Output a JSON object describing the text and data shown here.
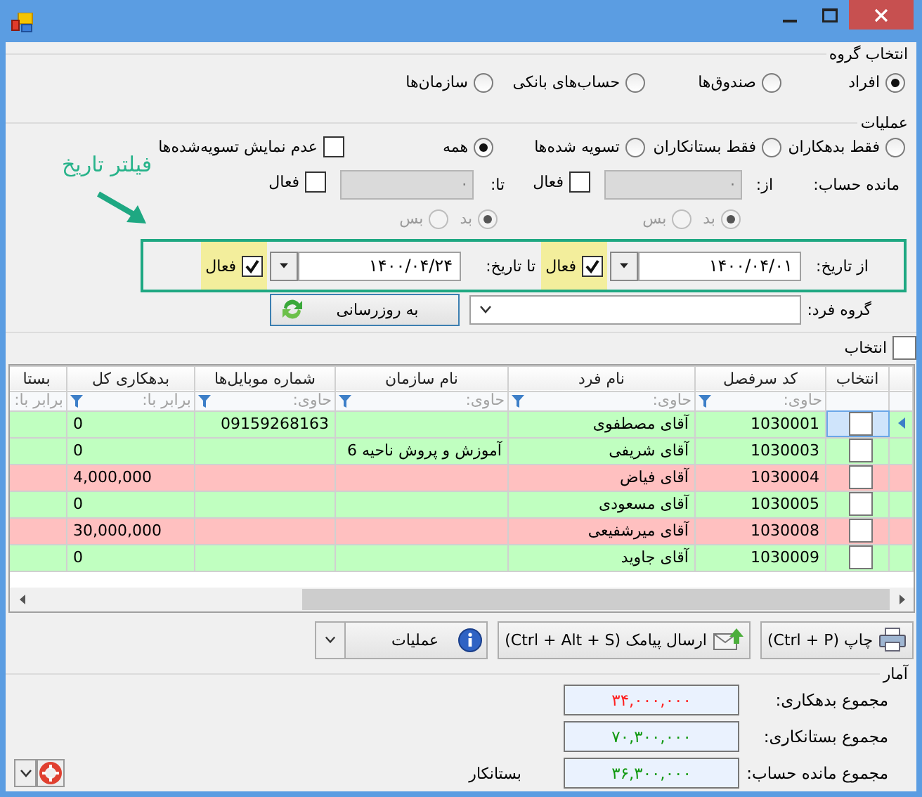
{
  "group_selection": {
    "legend": "انتخاب گروه",
    "options": [
      {
        "label": "افراد",
        "selected": true
      },
      {
        "label": "صندوق‌ها",
        "selected": false
      },
      {
        "label": "حساب‌های بانکی",
        "selected": false
      },
      {
        "label": "سازمان‌ها",
        "selected": false
      }
    ]
  },
  "operations": {
    "legend": "عملیات",
    "filters": [
      {
        "label": "فقط بدهکاران",
        "selected": false
      },
      {
        "label": "فقط بستانکاران",
        "selected": false
      },
      {
        "label": "تسویه شده‌ها",
        "selected": false
      },
      {
        "label": "همه",
        "selected": true
      }
    ],
    "hide_settled": {
      "label": "عدم نمایش تسویه‌شده‌ها",
      "checked": false
    },
    "balance": {
      "label": "مانده حساب:",
      "ranges": [
        {
          "label": "از:",
          "placeholder": "·",
          "disabled": true,
          "active": {
            "label": "فعال",
            "checked": false
          },
          "sides": [
            {
              "label": "بد",
              "selected": true,
              "disabled": true
            },
            {
              "label": "بس",
              "selected": false,
              "disabled": true
            }
          ]
        },
        {
          "label": "تا:",
          "placeholder": "·",
          "disabled": true,
          "active": {
            "label": "فعال",
            "checked": false
          },
          "sides": [
            {
              "label": "بد",
              "selected": true,
              "disabled": true
            },
            {
              "label": "بس",
              "selected": false,
              "disabled": true
            }
          ]
        }
      ]
    },
    "date_filter": {
      "annotation": "فیلتر تاریخ",
      "ranges": [
        {
          "label": "از تاریخ:",
          "value": "۱۴۰۰/۰۴/۰۱",
          "active": {
            "label": "فعال",
            "checked": true,
            "highlighted": true
          }
        },
        {
          "label": "تا تاریخ:",
          "value": "۱۴۰۰/۰۴/۲۴",
          "active": {
            "label": "فعال",
            "checked": true,
            "highlighted": true
          }
        }
      ]
    },
    "person_group": {
      "label": "گروه فرد:"
    },
    "refresh_button": {
      "label": "به روزرسانی"
    }
  },
  "grid": {
    "select_all": {
      "label": "انتخاب",
      "checked": false
    },
    "columns": [
      {
        "title": "انتخاب"
      },
      {
        "title": "کد سرفصل",
        "filter": "حاوی:",
        "filter_icon": true
      },
      {
        "title": "نام فرد",
        "filter": "حاوی:",
        "filter_icon": true
      },
      {
        "title": "نام سازمان",
        "filter": "حاوی:",
        "filter_icon": true
      },
      {
        "title": "شماره  موبایل‌ها",
        "filter": "حاوی:",
        "filter_icon": true
      },
      {
        "title": "بدهکاری کل",
        "filter": "برابر با:",
        "filter_icon": true
      },
      {
        "title": "بستا",
        "filter": "برابر با:",
        "filter_icon": false
      }
    ],
    "rows": [
      {
        "selected": true,
        "checked": false,
        "code": "1030001",
        "name": "آقای مصطفوی",
        "mobile": "09159268163",
        "debt": "0",
        "color": "#c0ffc0"
      },
      {
        "selected": false,
        "checked": false,
        "code": "1030003",
        "name": "آقای شریفی",
        "organization": "آموزش و پروش ناحیه 6",
        "debt": "0",
        "color": "#c0ffc0"
      },
      {
        "selected": false,
        "checked": false,
        "code": "1030004",
        "name": "آقای فیاض",
        "debt": "4,000,000",
        "color": "#ffc0c0"
      },
      {
        "selected": false,
        "checked": false,
        "code": "1030005",
        "name": "آقای مسعودی",
        "debt": "0",
        "color": "#c0ffc0"
      },
      {
        "selected": false,
        "checked": false,
        "code": "1030008",
        "name": "آقای میرشفیعی",
        "debt": "30,000,000",
        "color": "#ffc0c0"
      },
      {
        "selected": false,
        "checked": false,
        "code": "1030009",
        "name": "آقای جاوید",
        "debt": "0",
        "color": "#c0ffc0"
      }
    ]
  },
  "toolbar": {
    "buttons": [
      {
        "kind": "print",
        "label": "چاپ (Ctrl + P)"
      },
      {
        "kind": "sms",
        "label": "ارسال پیامک (Ctrl + Alt + S)"
      }
    ],
    "operations_menu": {
      "label": "عملیات"
    }
  },
  "stats": {
    "legend": "آمار",
    "items": [
      {
        "label": "مجموع بدهکاری:",
        "value": "۳۴,۰۰۰,۰۰۰",
        "color": "#ff2020"
      },
      {
        "label": "مجموع بستانکاری:",
        "value": "۷۰,۳۰۰,۰۰۰",
        "color": "#119911"
      },
      {
        "label": "مجموع مانده حساب:",
        "value": "۳۶,۳۰۰,۰۰۰",
        "color": "#119911",
        "note": "بستانکار"
      }
    ]
  }
}
